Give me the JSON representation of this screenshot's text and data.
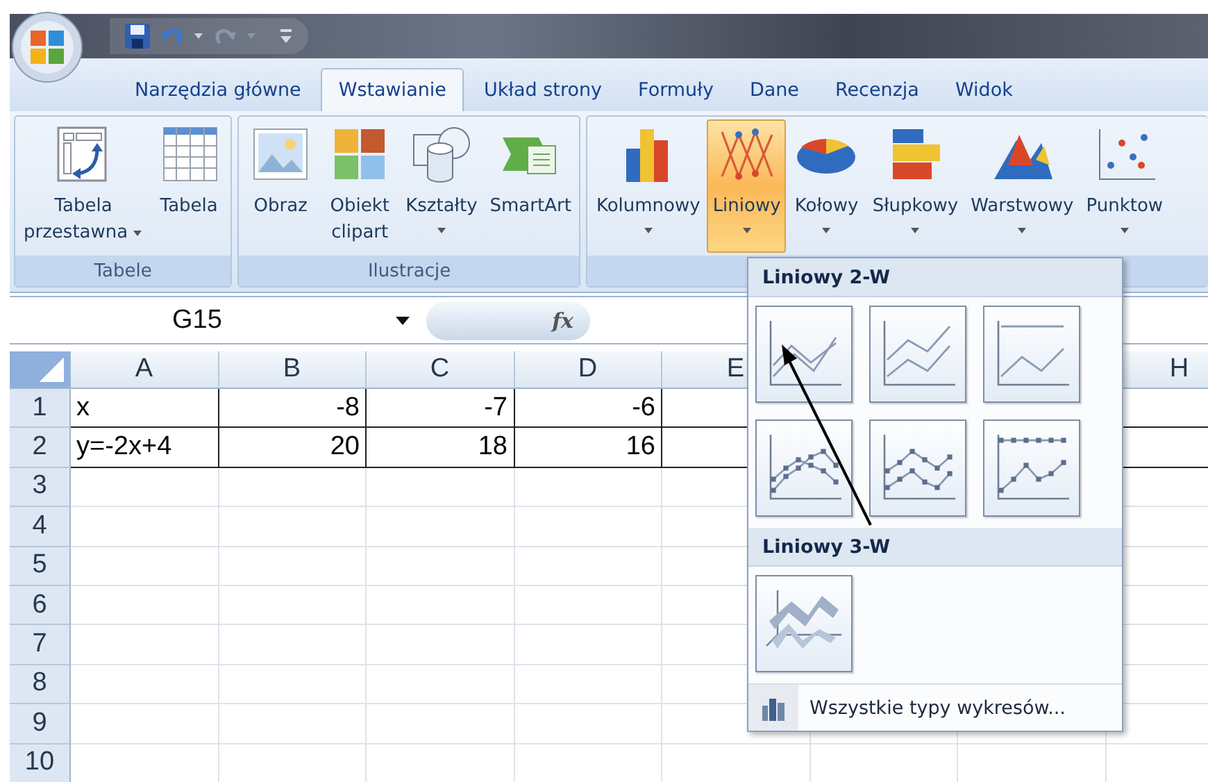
{
  "tabs": [
    {
      "label": "Narzędzia główne",
      "selected": false
    },
    {
      "label": "Wstawianie",
      "selected": true
    },
    {
      "label": "Układ strony",
      "selected": false
    },
    {
      "label": "Formuły",
      "selected": false
    },
    {
      "label": "Dane",
      "selected": false
    },
    {
      "label": "Recenzja",
      "selected": false
    },
    {
      "label": "Widok",
      "selected": false
    }
  ],
  "ribbon_groups": [
    {
      "label": "Tabele",
      "buttons": [
        {
          "kind": "pivot",
          "lines": [
            "Tabela",
            "przestawna"
          ],
          "dropdown": true,
          "selected": false
        },
        {
          "kind": "table",
          "lines": [
            "Tabela"
          ],
          "dropdown": false,
          "selected": false
        }
      ]
    },
    {
      "label": "Ilustracje",
      "buttons": [
        {
          "kind": "picture",
          "lines": [
            "Obraz"
          ],
          "dropdown": false,
          "selected": false
        },
        {
          "kind": "clipart",
          "lines": [
            "Obiekt",
            "clipart"
          ],
          "dropdown": false,
          "selected": false
        },
        {
          "kind": "shapes",
          "lines": [
            "Kształty"
          ],
          "dropdown": true,
          "selected": false
        },
        {
          "kind": "smartart",
          "lines": [
            "SmartArt"
          ],
          "dropdown": false,
          "selected": false
        }
      ]
    },
    {
      "buttons": [
        {
          "kind": "column",
          "lines": [
            "Kolumnowy"
          ],
          "dropdown": true,
          "selected": false
        },
        {
          "kind": "line",
          "lines": [
            "Liniowy"
          ],
          "dropdown": true,
          "selected": true
        },
        {
          "kind": "pie",
          "lines": [
            "Kołowy"
          ],
          "dropdown": true,
          "selected": false
        },
        {
          "kind": "bar",
          "lines": [
            "Słupkowy"
          ],
          "dropdown": true,
          "selected": false
        },
        {
          "kind": "area",
          "lines": [
            "Warstwowy"
          ],
          "dropdown": true,
          "selected": false
        },
        {
          "kind": "scatter",
          "lines": [
            "Punktow"
          ],
          "dropdown": true,
          "selected": false
        }
      ]
    }
  ],
  "formula_bar": {
    "name_box": "G15",
    "function_button": "fx"
  },
  "sheet": {
    "columns": [
      {
        "label": "A"
      },
      {
        "label": "B"
      },
      {
        "label": "C"
      },
      {
        "label": "D"
      },
      {
        "label": "E"
      },
      {},
      {},
      {
        "label": "H"
      }
    ],
    "rows": [
      {
        "number": "1",
        "bordered": true,
        "cells": [
          "x",
          "-8",
          "-7",
          "-6"
        ]
      },
      {
        "number": "2",
        "bordered": true,
        "cells": [
          "y=-2x+4",
          "20",
          "18",
          "16"
        ]
      },
      {
        "number": "3",
        "bordered": false
      },
      {
        "number": "4",
        "bordered": false
      },
      {
        "number": "5",
        "bordered": false
      },
      {
        "number": "6",
        "bordered": false
      },
      {
        "number": "7",
        "bordered": false
      },
      {
        "number": "8",
        "bordered": false
      },
      {
        "number": "9",
        "bordered": false
      },
      {
        "number": "10",
        "bordered": false
      }
    ]
  },
  "chart_menu": {
    "sections": [
      {
        "title": "Liniowy 2-W",
        "items": [
          {
            "kind": "line"
          },
          {
            "kind": "stacked_line"
          },
          {
            "kind": "stacked100_line"
          },
          {
            "kind": "line_markers"
          },
          {
            "kind": "stacked_line_markers"
          },
          {
            "kind": "stacked100_line_markers"
          }
        ]
      },
      {
        "title": "Liniowy 3-W",
        "items": [
          {
            "kind": "line_3d"
          }
        ]
      }
    ],
    "footer": "Wszystkie typy wykresów..."
  }
}
